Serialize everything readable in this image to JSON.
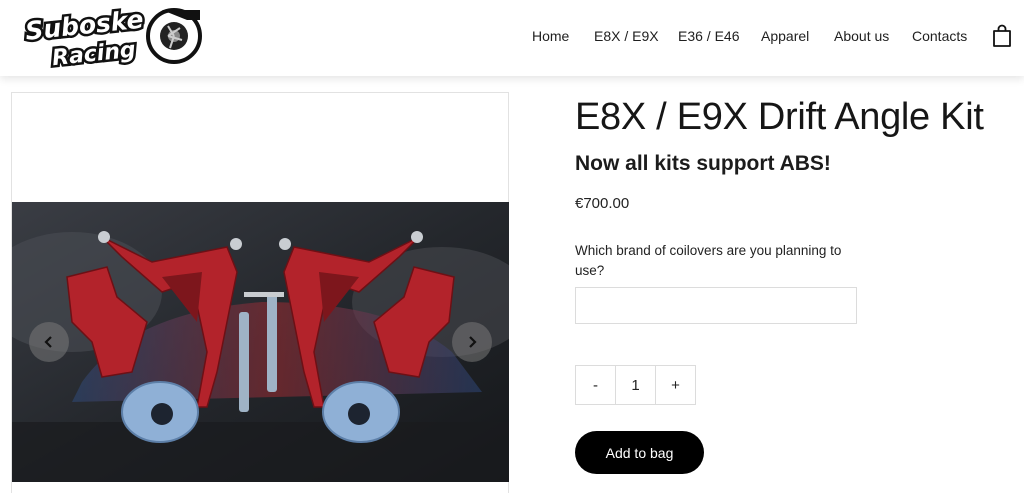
{
  "header": {
    "logo_text": "Suboske Racing",
    "nav": [
      {
        "label": "Home"
      },
      {
        "label": "E8X / E9X"
      },
      {
        "label": "E36 / E46"
      },
      {
        "label": "Apparel"
      },
      {
        "label": "About us"
      },
      {
        "label": "Contacts"
      }
    ],
    "cart_icon": "shopping-bag-icon"
  },
  "gallery": {
    "prev_icon": "chevron-left-icon",
    "next_icon": "chevron-right-icon"
  },
  "product": {
    "title": "E8X / E9X Drift Angle Kit",
    "subtitle": "Now all kits support ABS!",
    "price": "€700.00",
    "question": "Which brand of coilovers are you planning to use?",
    "answer_value": "",
    "quantity": {
      "minus_label": "-",
      "value": "1",
      "plus_label": "+"
    },
    "add_to_bag_label": "Add to bag"
  },
  "colors": {
    "accent_button": "#000000",
    "part_red": "#b3232b",
    "knuckle_blue": "#8fb0d6"
  }
}
